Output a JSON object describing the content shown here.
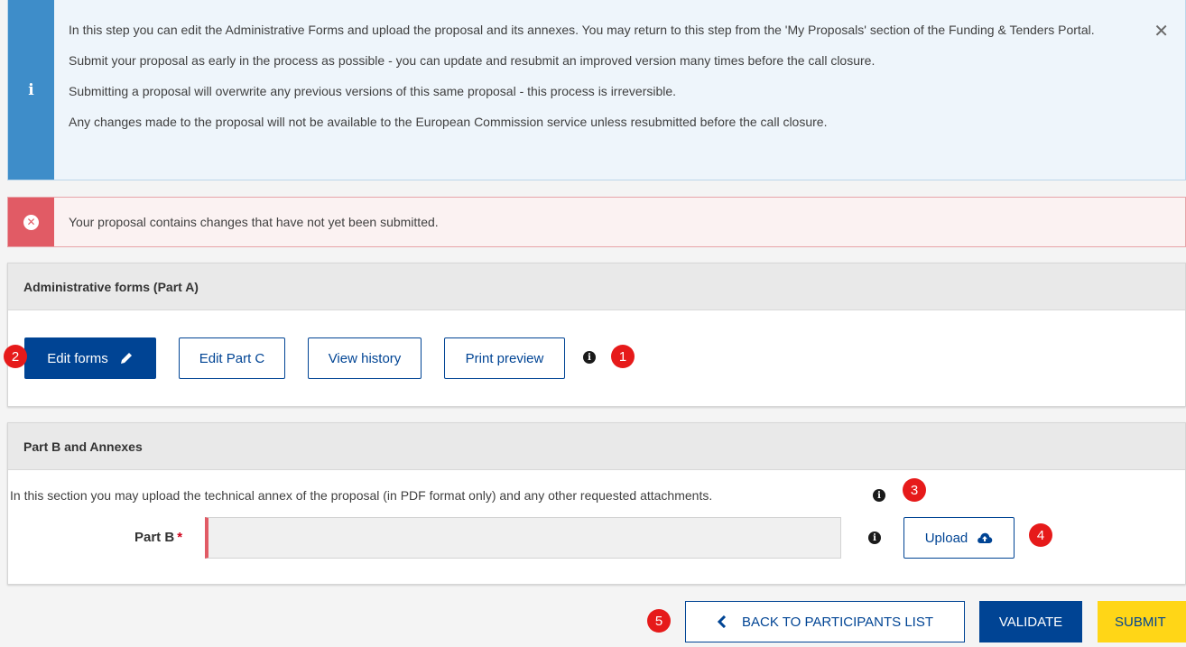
{
  "info": {
    "icon": "info-icon",
    "paragraphs": [
      "In this step you can edit the Administrative Forms and upload the proposal and its annexes. You may return to this step from the 'My Proposals' section of the Funding & Tenders Portal.",
      "Submit your proposal as early in the process as possible - you can update and resubmit an improved version many times before the call closure.",
      "Submitting a proposal will overwrite any previous versions of this same proposal - this process is irreversible.",
      "Any changes made to the proposal will not be available to the European Commission service unless resubmitted before the call closure."
    ],
    "close_glyph": "✕"
  },
  "error": {
    "icon": "error-icon",
    "glyph": "✕",
    "message": "Your proposal contains changes that have not yet been submitted."
  },
  "part_a": {
    "header": "Administrative forms (Part A)",
    "edit_forms": "Edit forms",
    "edit_part_c": "Edit Part C",
    "view_history": "View history",
    "print_preview": "Print preview",
    "info_glyph": "i"
  },
  "part_b": {
    "header": "Part B and Annexes",
    "description": "In this section you may upload the technical annex of the proposal (in PDF format only) and any other requested attachments.",
    "field_label": "Part B",
    "required_mark": "*",
    "upload_label": "Upload",
    "info_glyph": "i"
  },
  "footer": {
    "back": "BACK TO PARTICIPANTS LIST",
    "validate": "VALIDATE",
    "submit": "SUBMIT"
  },
  "badges": [
    "1",
    "2",
    "3",
    "4",
    "5"
  ],
  "colors": {
    "primary": "#004494",
    "info_stripe": "#3e8dc9",
    "error_stripe": "#e15b65",
    "badge": "#e61a1a",
    "submit": "#ffd617"
  }
}
